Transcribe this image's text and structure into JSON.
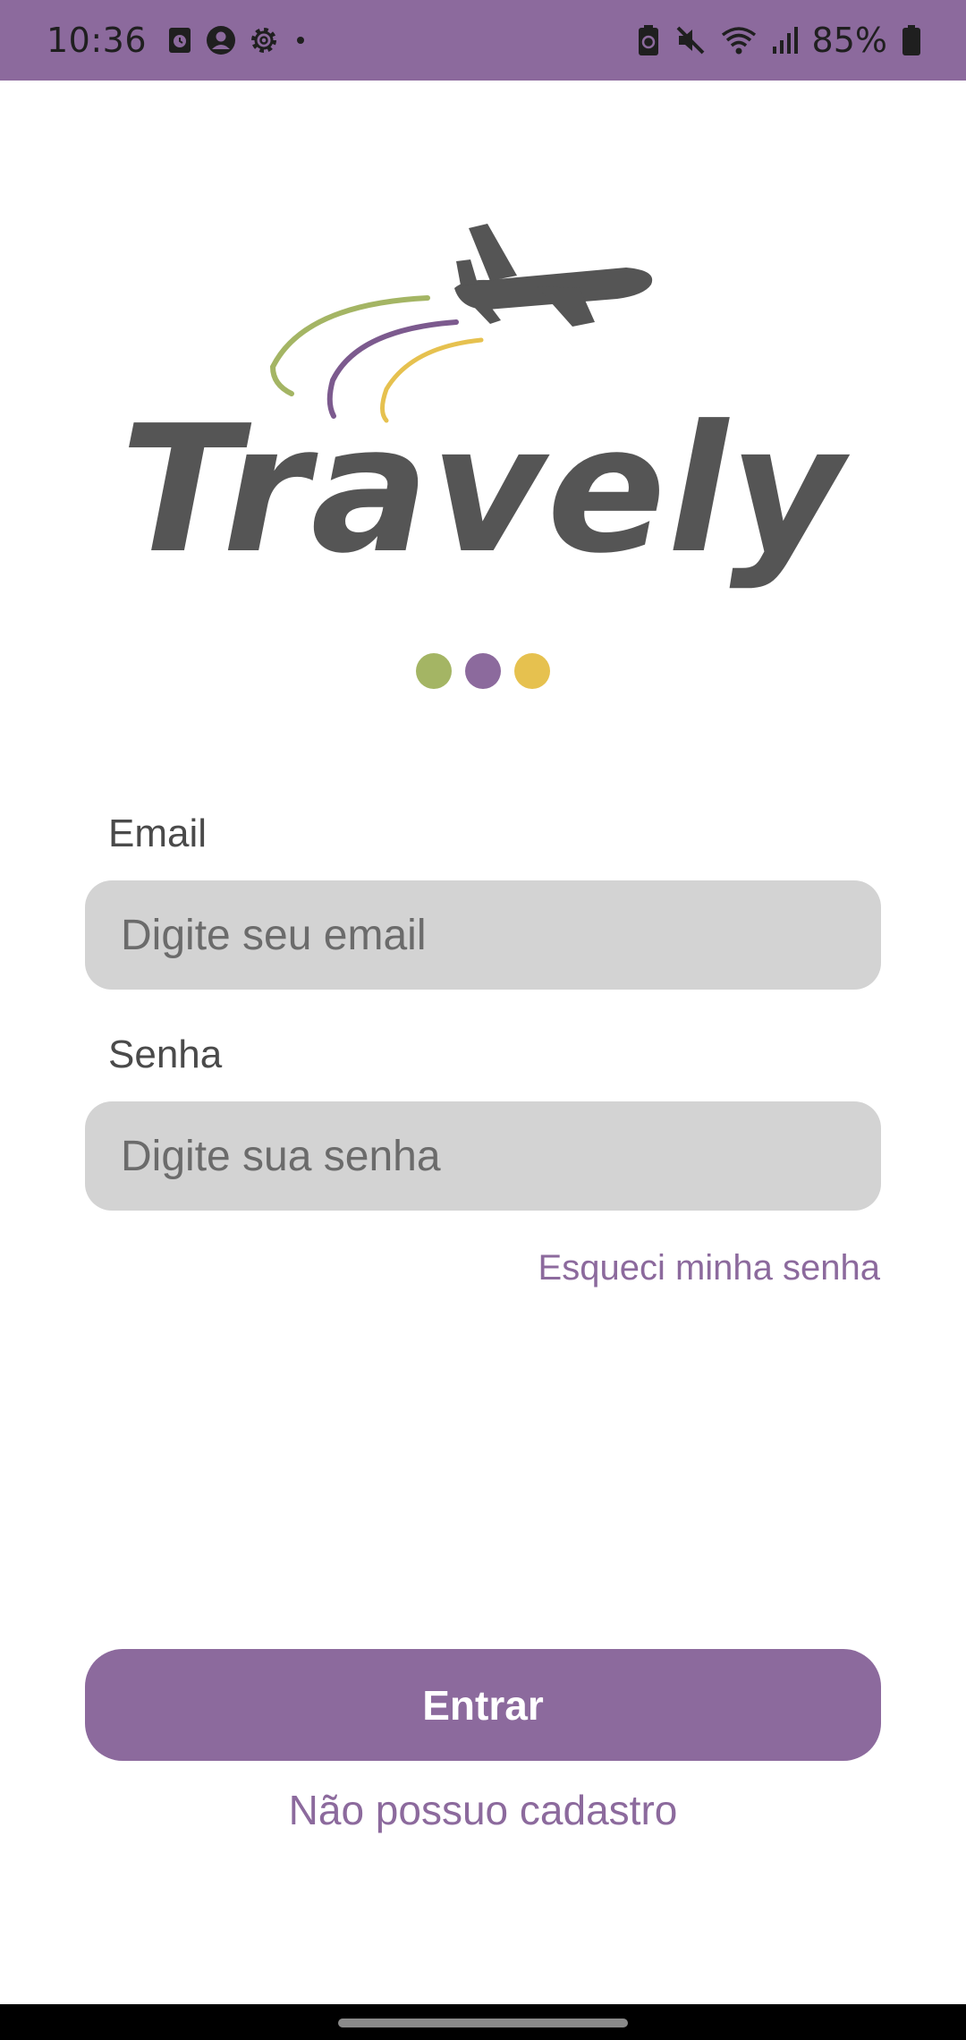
{
  "status_bar": {
    "time": "10:36",
    "battery_percent": "85%",
    "left_icons": [
      "timer-app-icon",
      "account-circle-icon",
      "settings-gear-icon",
      "notification-dot-icon"
    ],
    "right_icons": [
      "battery-saver-icon",
      "mute-icon",
      "wifi-icon",
      "signal-icon",
      "battery-icon"
    ]
  },
  "logo": {
    "text": "Travely",
    "colors": {
      "text": "#555555",
      "green": "#a4b564",
      "purple": "#7c5a8e",
      "yellow": "#e6c14f"
    }
  },
  "dots": [
    {
      "name": "green-dot",
      "color": "#a4b564"
    },
    {
      "name": "purple-dot",
      "color": "#8c6a9d"
    },
    {
      "name": "yellow-dot",
      "color": "#e6c14f"
    }
  ],
  "form": {
    "email_label": "Email",
    "email_placeholder": "Digite seu email",
    "email_value": "",
    "password_label": "Senha",
    "password_placeholder": "Digite sua senha",
    "password_value": "",
    "forgot_password": "Esqueci minha senha"
  },
  "actions": {
    "login": "Entrar",
    "register": "Não possuo cadastro"
  },
  "theme": {
    "primary": "#8c6a9d",
    "input_bg": "#d3d3d3"
  }
}
